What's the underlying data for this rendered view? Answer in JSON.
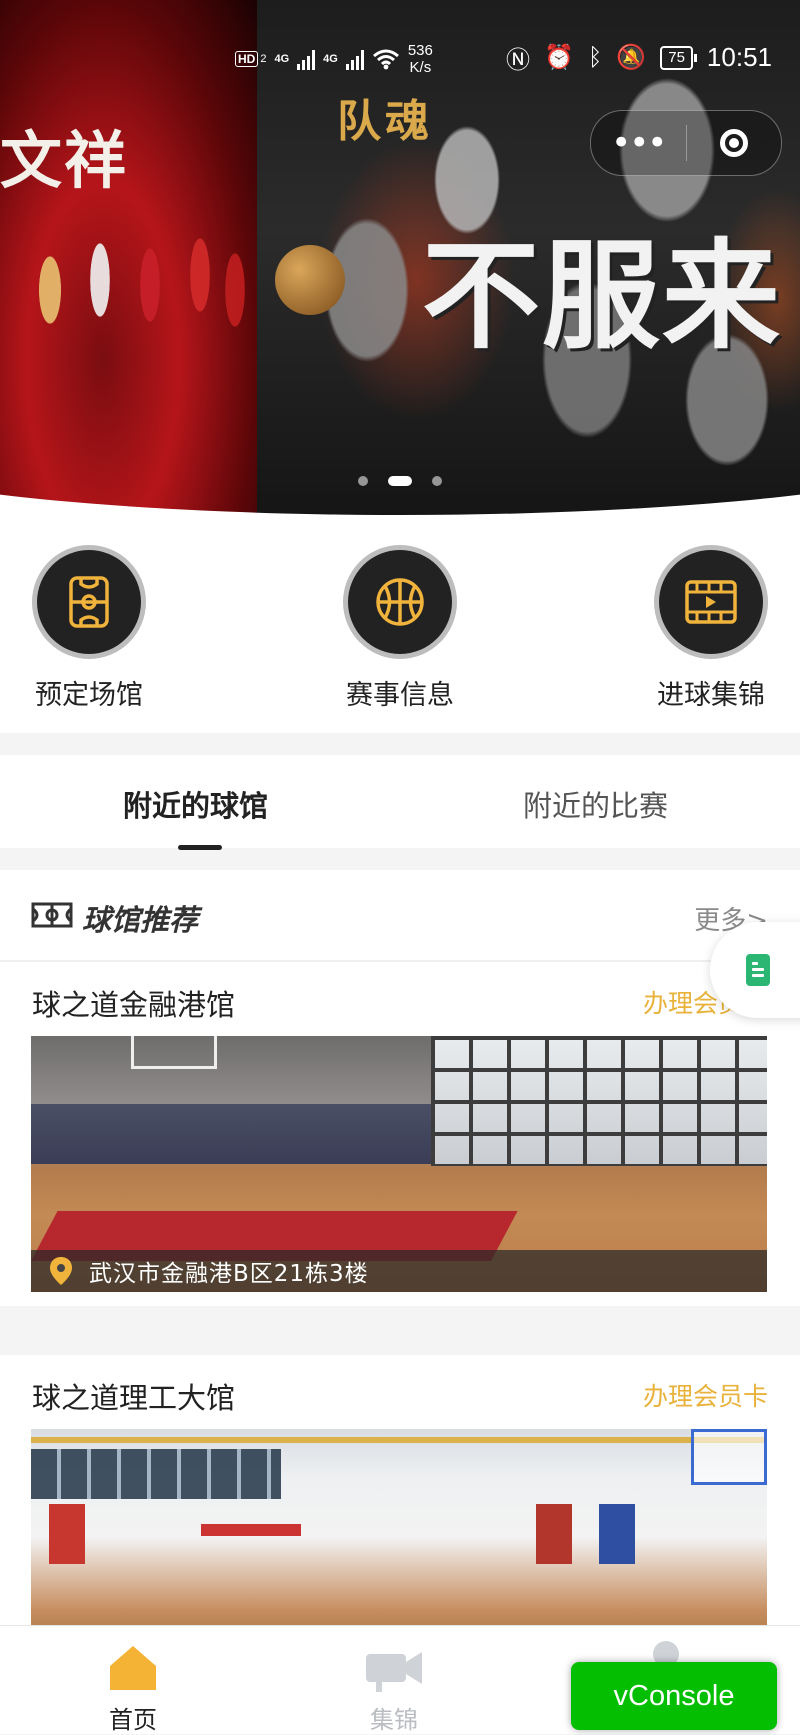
{
  "status_bar": {
    "network_badge": "HD",
    "network_sub": "2",
    "signal1": "4G",
    "signal2": "4G",
    "speed_value": "536",
    "speed_unit": "K/s",
    "battery": "75",
    "time": "10:51"
  },
  "banner": {
    "left_poster_text": "文祥",
    "right_poster_tag": "队魂",
    "right_poster_headline": "不服来",
    "slides": 3,
    "active_slide": 1
  },
  "quick_nav": [
    {
      "label": "预定场馆",
      "icon": "court-icon"
    },
    {
      "label": "赛事信息",
      "icon": "basketball-icon"
    },
    {
      "label": "进球集锦",
      "icon": "video-icon"
    }
  ],
  "tabs": {
    "nearby_venues": "附近的球馆",
    "nearby_matches": "附近的比赛"
  },
  "section": {
    "title": "球馆推荐",
    "more": "更多>"
  },
  "venues": [
    {
      "name": "球之道金融港馆",
      "action": "办理会员卡",
      "address": "武汉市金融港B区21栋3楼"
    },
    {
      "name": "球之道理工大馆",
      "action": "办理会员卡",
      "address": ""
    }
  ],
  "tab_bar": {
    "home": "首页",
    "highlights": "集锦"
  },
  "vconsole": "vConsole",
  "colors": {
    "accent": "#e8b23b",
    "icon_bg": "#222222",
    "vconsole": "#04be02"
  }
}
